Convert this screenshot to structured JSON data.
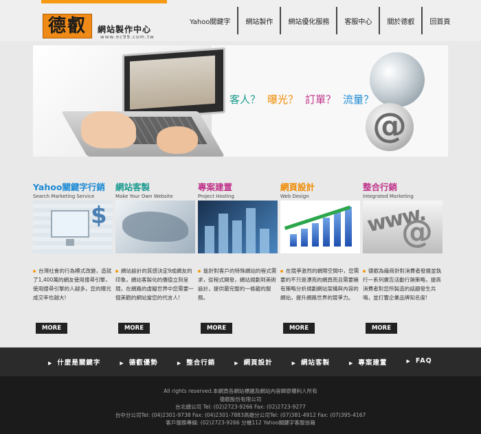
{
  "logo": {
    "mark": "德叡",
    "name": "網站製作中心",
    "url": "www.ec99.com.tw"
  },
  "nav": {
    "items": [
      "Yahoo關鍵字",
      "網站製作",
      "網站優化服務",
      "客服中心",
      "關於德叡",
      "回首頁"
    ]
  },
  "banner": {
    "tagline": [
      {
        "text": "客人？",
        "color": "#1a9a8f"
      },
      {
        "text": "曝光？",
        "color": "#f08a00"
      },
      {
        "text": "訂單？",
        "color": "#c0338a"
      },
      {
        "text": "流量？",
        "color": "#1c8ad4"
      }
    ]
  },
  "services": [
    {
      "title": "Yahoo關鍵字行銷",
      "subtitle": "Search Marketing Service",
      "color": "#1c8ad4",
      "text": "台灣社會的行為模式改變，造就了1,400萬的網友使用搜尋引擎，使用搜尋引擎的人越多，您的曝光成交率也越大!",
      "more": "MORE"
    },
    {
      "title": "網站客製",
      "subtitle": "Make Your Own Website",
      "color": "#1a9a8f",
      "text": "網站設計的質感決定9成網友的印象，網站客製化的價值立刻呈現，在網路的虛擬世界中您需要一個美觀的網站當您的代言人!",
      "more": "MORE"
    },
    {
      "title": "專案建置",
      "subtitle": "Project Hosting",
      "color": "#c0338a",
      "text": "能針對客戶的特殊網站的程式需求，從程式開發，網站規劃到美術設計，提供最完整的一條龍的服務。",
      "more": "MORE"
    },
    {
      "title": "網頁設計",
      "subtitle": "Web Design",
      "color": "#f08a00",
      "text": "在競爭激烈的網際空間中，您需要的不只是漂亮的網頁而且需要擁有策略分析規劃網站架構與內容的網站，提升網路世界的競爭力。",
      "more": "MORE"
    },
    {
      "title": "整合行銷",
      "subtitle": "Integrated Marketing",
      "color": "#c0338a",
      "text": "德叡為廠商針對消費者發展並執行一系列廣告活動行銷策略，提高消費者對您所製造的話題發生共鳴，並打響企業品牌知名度!",
      "more": "MORE"
    }
  ],
  "footer_nav": {
    "items": [
      "什麼是關鍵字",
      "德叡優勢",
      "整合行銷",
      "網頁設計",
      "網站客製",
      "專案建置",
      "FAQ"
    ]
  },
  "footer": {
    "lines": [
      "All rights reserved.本網頁各網站標題及網站內容歸原權利人所有",
      "德叡股份有限公司",
      "台北總公司 Tel: (02)2723-9266 Fax: (02)2723-9277",
      "台中分公司Tel: (04)2301-9738 Fax: (04)2301-7883高雄分公司Tel: (07)381-4912 Fax: (07)395-4167",
      "客戶服務專線: (02)2723-9266 分機112   Yahoo關鍵字客服信箱"
    ]
  }
}
